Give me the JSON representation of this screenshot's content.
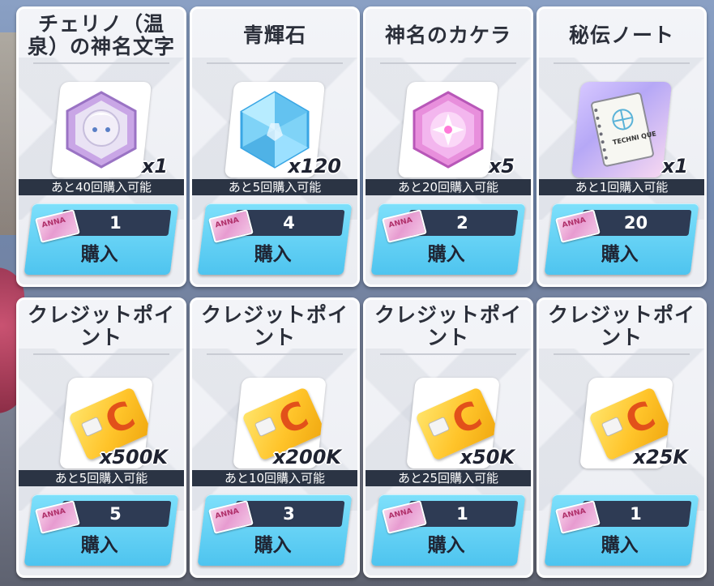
{
  "shop": {
    "items": [
      {
        "title": "チェリノ（温泉）の神名文字",
        "icon": "portrait-hexagon-icon",
        "quantity": "x1",
        "remaining": "あと40回購入可能",
        "price": "1",
        "buy_label": "購入"
      },
      {
        "title": "青輝石",
        "icon": "blue-crystal-icon",
        "quantity": "x120",
        "remaining": "あと5回購入可能",
        "price": "4",
        "buy_label": "購入"
      },
      {
        "title": "神名のカケラ",
        "icon": "pink-star-shard-icon",
        "quantity": "x5",
        "remaining": "あと20回購入可能",
        "price": "2",
        "buy_label": "購入"
      },
      {
        "title": "秘伝ノート",
        "icon": "secret-notebook-icon",
        "quantity": "x1",
        "remaining": "あと1回購入可能",
        "price": "20",
        "buy_label": "購入"
      },
      {
        "title": "クレジットポイント",
        "icon": "credit-card-icon",
        "quantity": "x500K",
        "remaining": "あと5回購入可能",
        "price": "5",
        "buy_label": "購入"
      },
      {
        "title": "クレジットポイント",
        "icon": "credit-card-icon",
        "quantity": "x200K",
        "remaining": "あと10回購入可能",
        "price": "3",
        "buy_label": "購入"
      },
      {
        "title": "クレジットポイント",
        "icon": "credit-card-icon",
        "quantity": "x50K",
        "remaining": "あと25回購入可能",
        "price": "1",
        "buy_label": "購入"
      },
      {
        "title": "クレジットポイント",
        "icon": "credit-card-icon",
        "quantity": "x25K",
        "remaining": "",
        "price": "1",
        "buy_label": "購入"
      }
    ],
    "notebook_text": "TECHNI QUE",
    "ticket_text": "ANNA"
  }
}
